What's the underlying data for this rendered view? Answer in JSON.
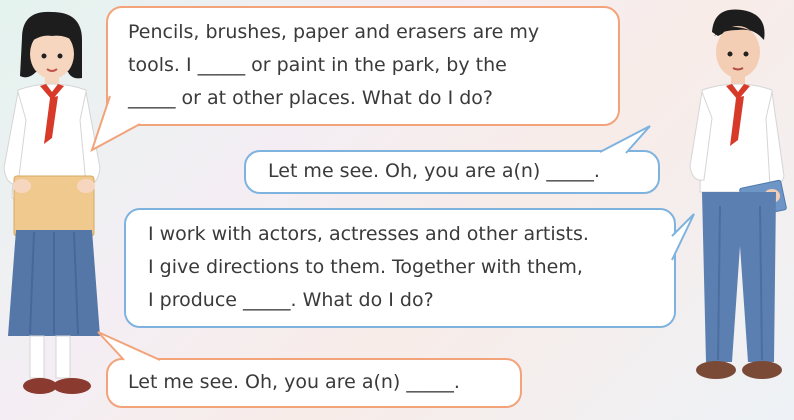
{
  "dialogue": {
    "bubble1": {
      "lines": [
        "Pencils, brushes, paper and erasers are my",
        "tools. I _____ or paint in the park, by the",
        "_____ or at other places. What do I do?"
      ]
    },
    "bubble2": {
      "text": "Let me see. Oh, you are a(n) _____."
    },
    "bubble3": {
      "lines": [
        "I work with actors, actresses and other artists.",
        "I give directions to them. Together with them,",
        "I produce _____. What do I do?"
      ]
    },
    "bubble4": {
      "text": "Let me see. Oh, you are a(n) _____."
    }
  },
  "colors": {
    "orange_border": "#f2a37a",
    "blue_border": "#7fb3df",
    "shirt": "#ffffff",
    "scarf": "#d83a2a",
    "skirt": "#5577a8",
    "trousers": "#5b7fb0",
    "hair": "#1d1d1d"
  },
  "icons": [
    "girl-student-figure",
    "boy-student-figure"
  ]
}
